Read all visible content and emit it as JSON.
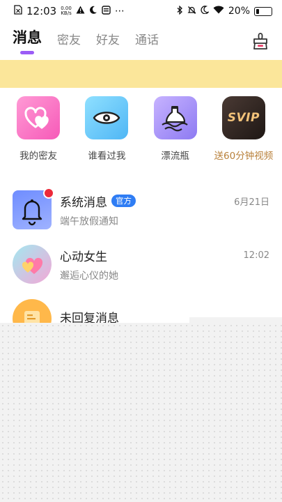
{
  "status_bar": {
    "time": "12:03",
    "net_speed_value": "0.00",
    "net_speed_unit": "KB/s",
    "battery": "20%",
    "battery_level": 0.2
  },
  "tabs": [
    {
      "label": "消息",
      "active": true
    },
    {
      "label": "密友",
      "active": false
    },
    {
      "label": "好友",
      "active": false
    },
    {
      "label": "通话",
      "active": false
    }
  ],
  "quick_entries": [
    {
      "label": "我的密友",
      "icon": "hearts-icon"
    },
    {
      "label": "谁看过我",
      "icon": "eye-icon"
    },
    {
      "label": "漂流瓶",
      "icon": "drift-bottle-icon"
    },
    {
      "label": "送60分钟视频",
      "icon": "svip-icon",
      "icon_text": "SVIP"
    }
  ],
  "messages": [
    {
      "title": "系统消息",
      "badge": "官方",
      "time": "6月21日",
      "preview": "端午放假通知",
      "unread": true
    },
    {
      "title": "心动女生",
      "time": "12:02",
      "preview": "邂逅心仪的她"
    },
    {
      "title": "未回复消息",
      "preview": ""
    }
  ],
  "colors": {
    "accent": "#9b5cf6",
    "banner": "#fbe69a",
    "official_badge": "#2f7df4",
    "unread_dot": "#ec2a3a",
    "svip_label": "#b8803a"
  }
}
